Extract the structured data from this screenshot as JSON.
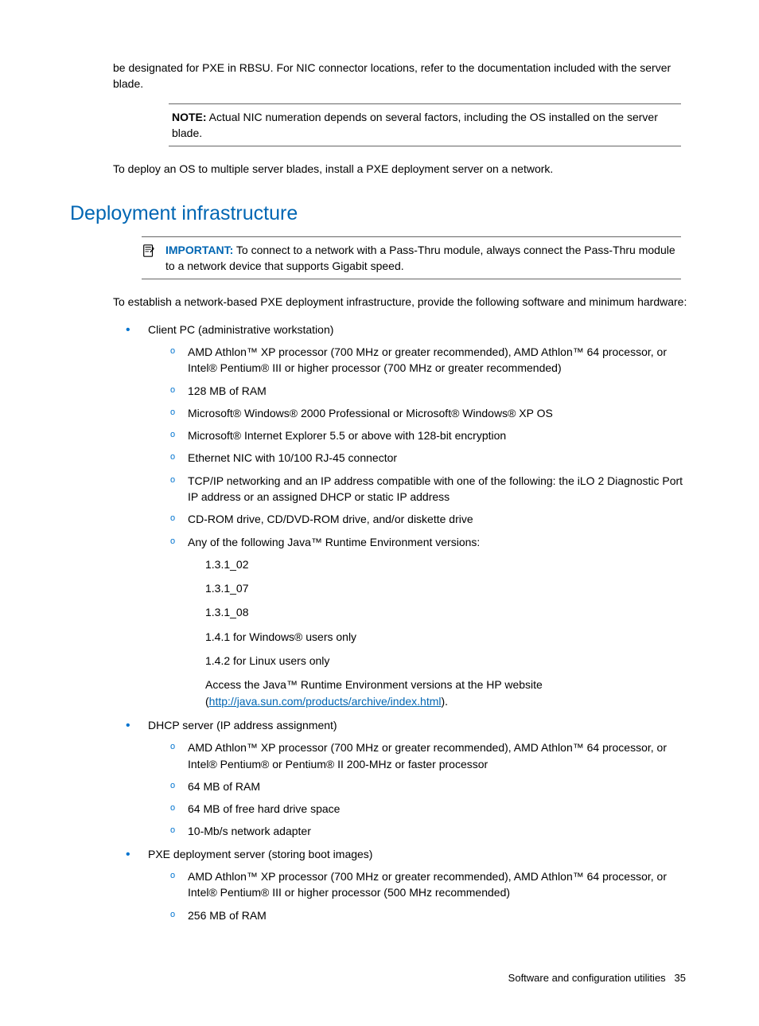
{
  "intro": {
    "p1": "be designated for PXE in RBSU. For NIC connector locations, refer to the documentation included with the server blade.",
    "p2": "To deploy an OS to multiple server blades, install a PXE deployment server on a network."
  },
  "note": {
    "label": "NOTE:",
    "text": "  Actual NIC numeration depends on several factors, including the OS installed on the server blade."
  },
  "section": {
    "heading": "Deployment infrastructure"
  },
  "important": {
    "label": "IMPORTANT:",
    "text": "  To connect to a network with a Pass-Thru module, always connect the Pass-Thru module to a network device that supports Gigabit speed."
  },
  "lead": "To establish a network-based PXE deployment infrastructure, provide the following software and minimum hardware:",
  "list": {
    "item1": {
      "label": "Client PC (administrative workstation)",
      "subs": {
        "s1": "AMD Athlon™ XP processor (700 MHz or greater recommended), AMD Athlon™ 64 processor, or Intel® Pentium® III or higher processor (700 MHz or greater recommended)",
        "s2": "128 MB of RAM",
        "s3": "Microsoft® Windows® 2000 Professional or Microsoft® Windows® XP OS",
        "s4": "Microsoft® Internet Explorer 5.5 or above with 128-bit encryption",
        "s5": "Ethernet NIC with 10/100 RJ-45 connector",
        "s6": "TCP/IP networking and an IP address compatible with one of the following: the iLO 2 Diagnostic Port IP address or an assigned DHCP or static IP address",
        "s7": "CD-ROM drive, CD/DVD-ROM drive, and/or diskette drive",
        "s8": "Any of the following Java™ Runtime Environment versions:"
      },
      "java": {
        "v1": "1.3.1_02",
        "v2": "1.3.1_07",
        "v3": "1.3.1_08",
        "v4": "1.4.1 for Windows® users only",
        "v5": "1.4.2 for Linux users only",
        "access_prefix": "Access the Java™ Runtime Environment versions at the HP website (",
        "link": "http://java.sun.com/products/archive/index.html",
        "access_suffix": ")."
      }
    },
    "item2": {
      "label": "DHCP server (IP address assignment)",
      "subs": {
        "s1": "AMD Athlon™ XP processor (700 MHz or greater recommended), AMD Athlon™ 64 processor, or Intel® Pentium® or Pentium® II 200-MHz or faster processor",
        "s2": "64 MB of RAM",
        "s3": "64 MB of free hard drive space",
        "s4": "10-Mb/s network adapter"
      }
    },
    "item3": {
      "label": "PXE deployment server (storing boot images)",
      "subs": {
        "s1": "AMD Athlon™ XP processor (700 MHz or greater recommended), AMD Athlon™ 64 processor, or Intel® Pentium® III or higher processor (500 MHz recommended)",
        "s2": "256 MB of RAM"
      }
    }
  },
  "footer": {
    "section": "Software and configuration utilities",
    "page": "35"
  }
}
